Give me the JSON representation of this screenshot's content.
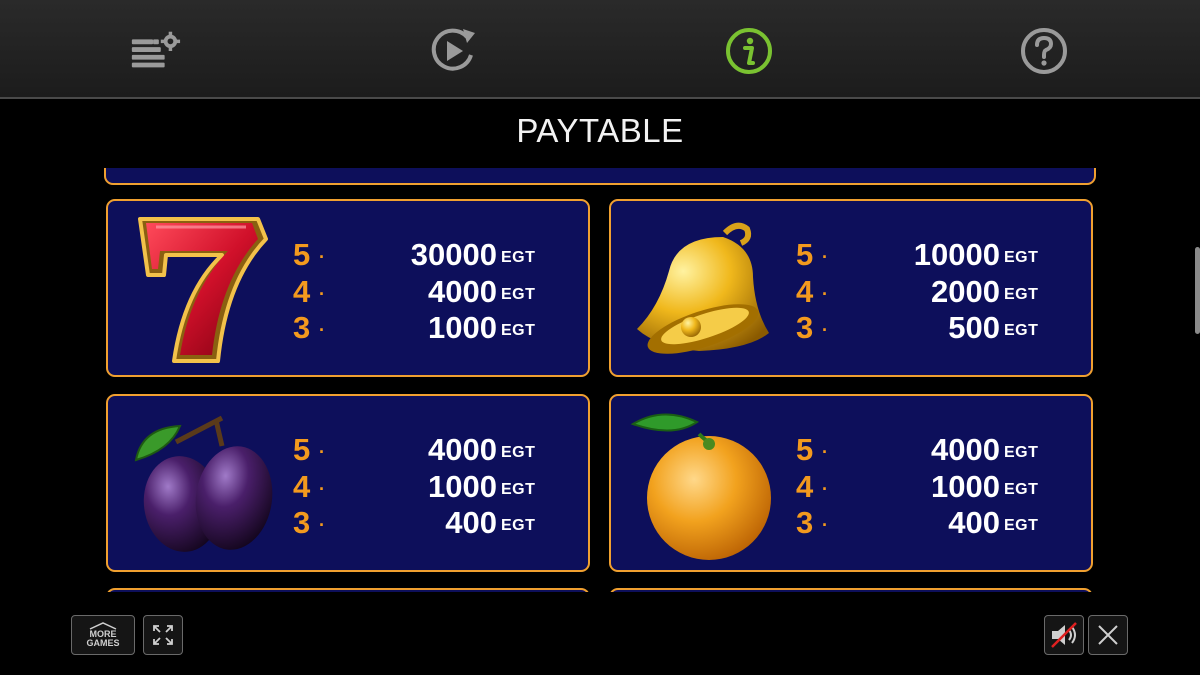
{
  "toolbar": {
    "buttons": [
      {
        "icon": "bet-settings-icon"
      },
      {
        "icon": "autoplay-icon"
      },
      {
        "icon": "info-icon",
        "active": true,
        "accent": "#7ac231"
      },
      {
        "icon": "help-icon"
      }
    ]
  },
  "title": "PAYTABLE",
  "paytable": [
    {
      "symbol": "seven",
      "rows": [
        {
          "count": "5",
          "amount": "30000",
          "unit": "EGT"
        },
        {
          "count": "4",
          "amount": "4000",
          "unit": "EGT"
        },
        {
          "count": "3",
          "amount": "1000",
          "unit": "EGT"
        }
      ]
    },
    {
      "symbol": "bell",
      "rows": [
        {
          "count": "5",
          "amount": "10000",
          "unit": "EGT"
        },
        {
          "count": "4",
          "amount": "2000",
          "unit": "EGT"
        },
        {
          "count": "3",
          "amount": "500",
          "unit": "EGT"
        }
      ]
    },
    {
      "symbol": "plum",
      "rows": [
        {
          "count": "5",
          "amount": "4000",
          "unit": "EGT"
        },
        {
          "count": "4",
          "amount": "1000",
          "unit": "EGT"
        },
        {
          "count": "3",
          "amount": "400",
          "unit": "EGT"
        }
      ]
    },
    {
      "symbol": "orange",
      "rows": [
        {
          "count": "5",
          "amount": "4000",
          "unit": "EGT"
        },
        {
          "count": "4",
          "amount": "1000",
          "unit": "EGT"
        },
        {
          "count": "3",
          "amount": "400",
          "unit": "EGT"
        }
      ]
    }
  ],
  "bottom": {
    "more_games_line1": "MORE",
    "more_games_line2": "GAMES"
  },
  "colors": {
    "card_bg": "#0d0f5b",
    "card_border": "#f0a030",
    "count_color": "#f39a1e"
  }
}
